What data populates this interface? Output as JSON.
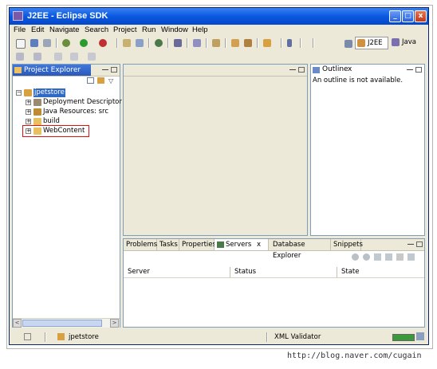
{
  "window": {
    "title": "J2EE - Eclipse SDK",
    "buttons": {
      "minimize": "_",
      "maximize": "□",
      "close": "x"
    }
  },
  "menu": [
    "File",
    "Edit",
    "Navigate",
    "Search",
    "Project",
    "Run",
    "Window",
    "Help"
  ],
  "perspectives": {
    "active": "J2EE",
    "other": "Java"
  },
  "project_explorer": {
    "title": "Project Explorer",
    "close": "x",
    "tree": {
      "root": "jpetstore",
      "children": [
        "Deployment Descriptor",
        "Java Resources: src",
        "build",
        "WebContent"
      ]
    },
    "scroll_left": "<",
    "scroll_right": ">"
  },
  "outline": {
    "title": "Outline",
    "close": "x",
    "message": "An outline is not available."
  },
  "bottom_tabs": {
    "tabs": [
      "Problems",
      "Tasks",
      "Properties",
      "Servers",
      "Database Explorer",
      "Snippets"
    ],
    "active": "Servers",
    "active_close": "x",
    "columns": [
      "Server",
      "Status",
      "State"
    ]
  },
  "statusbar": {
    "selection": "jpetstore",
    "task": "XML Validator"
  },
  "caption": "http://blog.naver.com/cugain",
  "colors": {
    "title_bar": "#0a58e0",
    "highlight_box": "#e01010",
    "active_tab": "#2a58b8"
  }
}
